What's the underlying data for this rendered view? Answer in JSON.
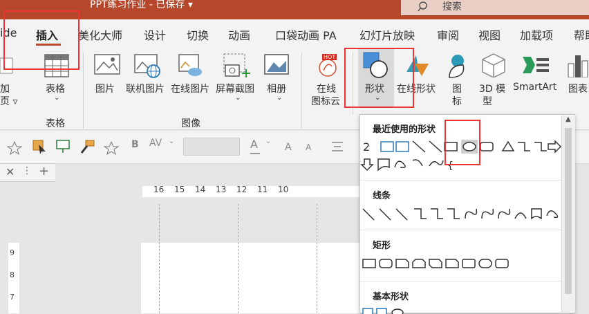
{
  "window": {
    "title": "PPT练习作业 - 已保存 ▾",
    "search_label": "搜索"
  },
  "tabs": [
    "ide",
    "插入",
    "美化大师",
    "设计",
    "切换",
    "动画",
    "口袋动画 PA",
    "幻灯片放映",
    "审阅",
    "视图",
    "加载项",
    "帮助"
  ],
  "ribbon": {
    "partial_left": [
      "加",
      "页 ▿"
    ],
    "table_label": "表格",
    "table_group": "表格",
    "picture": "图片",
    "online_picture_joint": "联机图片",
    "online_picture": "在线图片",
    "screenshot": "屏幕截图",
    "album": "相册",
    "image_group": "图像",
    "online_icon_cloud": [
      "在线",
      "图标云"
    ],
    "shapes": "形状",
    "online_shapes": "在线形状",
    "icons": [
      "图",
      "标"
    ],
    "model3d": [
      "3D 模",
      "型"
    ],
    "smartart": "SmartArt",
    "chart": "图表",
    "hot": "HOT"
  },
  "formatbar": {
    "bold": "B",
    "spacing": "AV",
    "font_color": "A"
  },
  "dropdown": {
    "recent_title": "最近使用的形状",
    "lines_title": "线条",
    "rect_title": "矩形",
    "basic_title": "基本形状"
  },
  "ruler": {
    "labels": [
      "16",
      "15",
      "14",
      "13",
      "12",
      "11",
      "10"
    ],
    "vlabels": [
      "9",
      "8",
      "7"
    ]
  },
  "colors": {
    "brand": "#b7472a",
    "highlight_box": "#e33333",
    "shape_fill": "#4a90d9"
  }
}
